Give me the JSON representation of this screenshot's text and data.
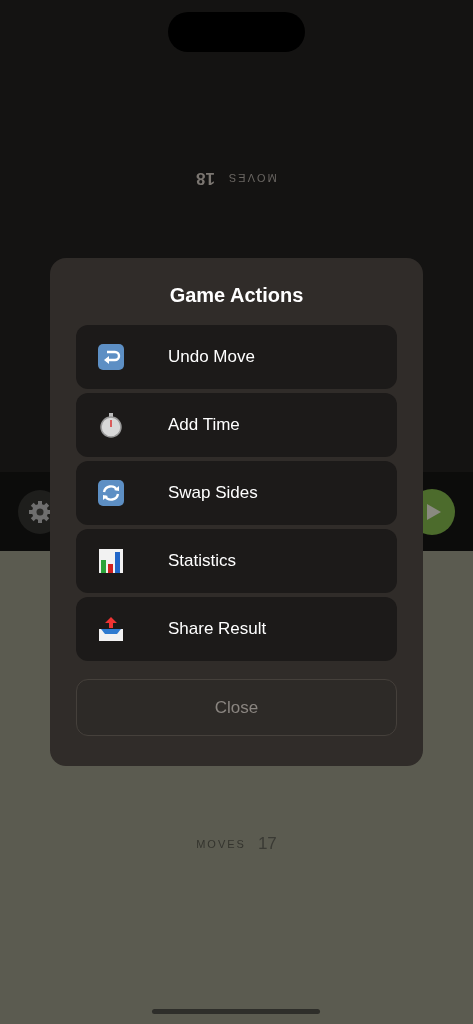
{
  "top_player": {
    "moves_label": "MOVES",
    "moves": "18"
  },
  "bottom_player": {
    "moves_label": "MOVES",
    "moves": "17"
  },
  "dialog": {
    "title": "Game Actions",
    "actions": [
      {
        "kind": "undo",
        "label": "Undo Move"
      },
      {
        "kind": "stopwatch",
        "label": "Add Time"
      },
      {
        "kind": "swap",
        "label": "Swap Sides"
      },
      {
        "kind": "chart",
        "label": "Statistics"
      },
      {
        "kind": "share",
        "label": "Share Result"
      }
    ],
    "close": "Close"
  }
}
